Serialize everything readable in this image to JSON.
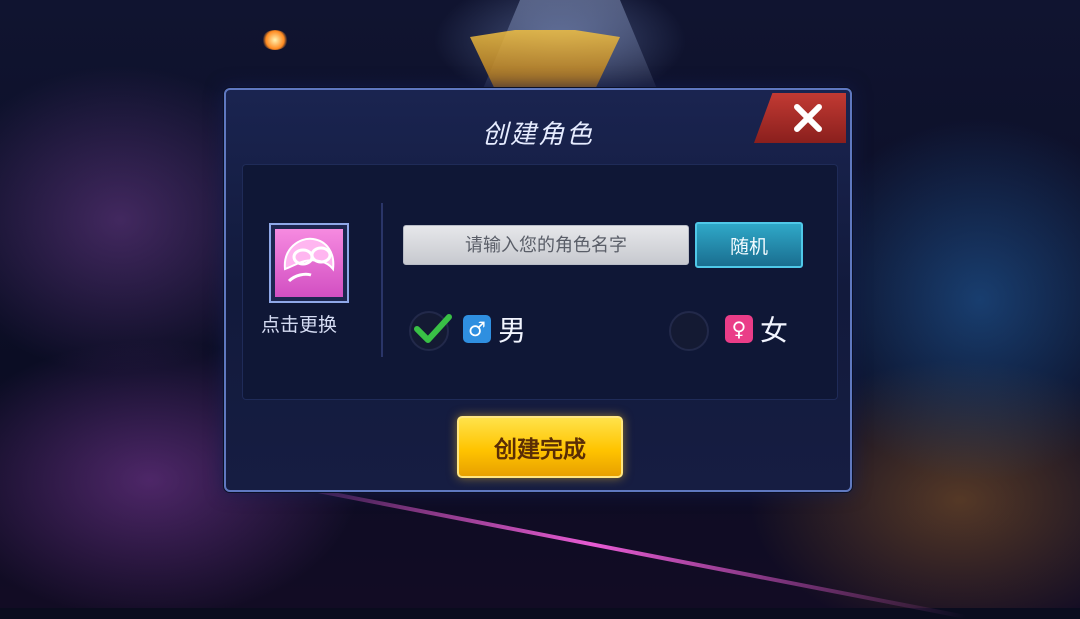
{
  "dialog": {
    "title": "创建角色",
    "avatar_change_label": "点击更换",
    "name_placeholder": "请输入您的角色名字",
    "random_label": "随机",
    "gender": {
      "selected": "male",
      "male_label": "男",
      "female_label": "女"
    },
    "create_label": "创建完成"
  },
  "icons": {
    "close": "close-icon",
    "male": "male-symbol-icon",
    "female": "female-symbol-icon",
    "check": "check-icon"
  },
  "colors": {
    "dialog_bg": "#121a3c",
    "dialog_border": "#5f78c0",
    "close_red": "#c23a33",
    "random_teal": "#2fa8c8",
    "create_yellow": "#ffc400",
    "check_green": "#39c046",
    "male_blue": "#2f8fe0",
    "female_pink": "#ea3d88",
    "avatar_pink": "#f68ae0"
  }
}
